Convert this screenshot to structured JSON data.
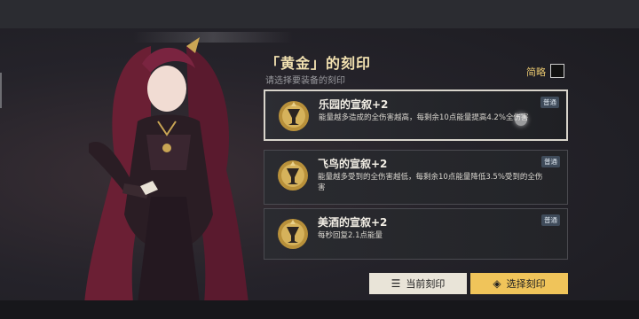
{
  "header": {
    "title": "「黄金」的刻印",
    "subtitle": "请选择要装备的刻印",
    "compact_label": "简略"
  },
  "cards": [
    {
      "name": "乐园的宣叙+2",
      "desc": "能量越多造成的全伤害越高，每剩余10点能量提高4.2%全伤害",
      "badge": "普通",
      "selected": true
    },
    {
      "name": "飞鸟的宣叙+2",
      "desc": "能量越多受到的全伤害越低，每剩余10点能量降低3.5%受到的全伤害",
      "badge": "普通",
      "selected": false
    },
    {
      "name": "美酒的宣叙+2",
      "desc": "每秒回复2.1点能量",
      "badge": "普通",
      "selected": false
    }
  ],
  "buttons": {
    "current": "当前刻印",
    "select": "选择刻印"
  },
  "icons": {
    "current": "list-icon",
    "select": "seal-icon",
    "emblem": "goblet-emblem-icon"
  },
  "colors": {
    "accent_gold": "#f0c45a",
    "title_gold": "#f2e1b0"
  }
}
